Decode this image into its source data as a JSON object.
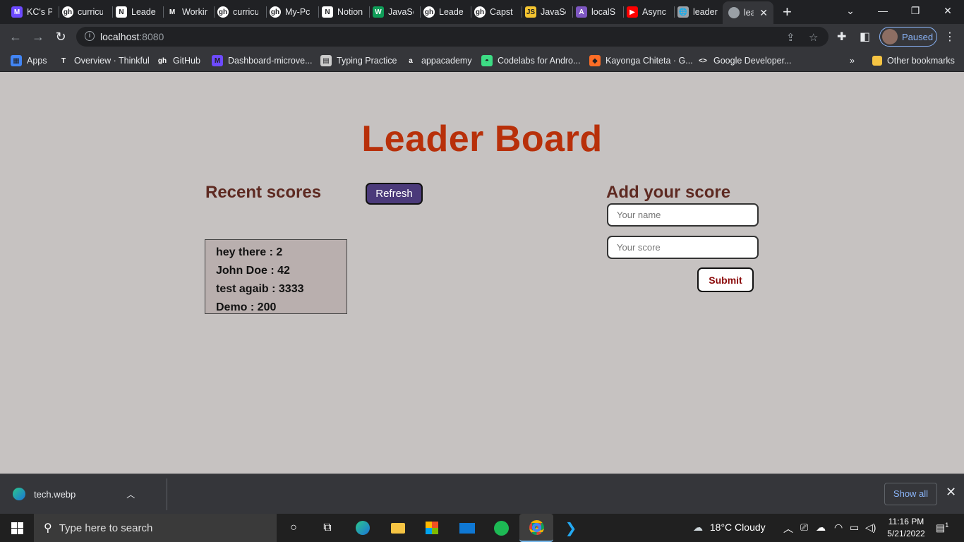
{
  "browser": {
    "tabs": [
      {
        "title": "KC's P",
        "color": "#6d4aff",
        "icon": "M"
      },
      {
        "title": "curricu",
        "color": "#ffffff",
        "icon": "gh"
      },
      {
        "title": "Leade",
        "color": "#ffffff",
        "icon": "N"
      },
      {
        "title": "Workin",
        "color": "#202124",
        "icon": "M"
      },
      {
        "title": "curricu",
        "color": "#ffffff",
        "icon": "gh"
      },
      {
        "title": "My-Pc",
        "color": "#ffffff",
        "icon": "gh"
      },
      {
        "title": "Notion",
        "color": "#ffffff",
        "icon": "N"
      },
      {
        "title": "JavaSc",
        "color": "#0f9d58",
        "icon": "W"
      },
      {
        "title": "Leade",
        "color": "#ffffff",
        "icon": "gh"
      },
      {
        "title": "Capst",
        "color": "#ffffff",
        "icon": "gh"
      },
      {
        "title": "JavaSc",
        "color": "#f4c430",
        "icon": "JS"
      },
      {
        "title": "localS",
        "color": "#7e57c2",
        "icon": "A"
      },
      {
        "title": "Async",
        "color": "#ff0000",
        "icon": "▶"
      },
      {
        "title": "leader",
        "color": "#9aa0a6",
        "icon": "🌐"
      }
    ],
    "active_tab": {
      "title": "lea",
      "icon": "🌐"
    },
    "url_host": "localhost",
    "url_port": ":8080",
    "profile_label": "Paused",
    "bookmarks": [
      {
        "label": "Apps",
        "color": "#4285f4",
        "icon": "▦"
      },
      {
        "label": "Overview · Thinkful",
        "color": "#ffffff",
        "icon": "T"
      },
      {
        "label": "GitHub",
        "color": "#ffffff",
        "icon": "gh"
      },
      {
        "label": "Dashboard-microve...",
        "color": "#6d4aff",
        "icon": "M"
      },
      {
        "label": "Typing Practice",
        "color": "#cccccc",
        "icon": "▤"
      },
      {
        "label": "appacademy",
        "color": "#111111",
        "icon": "a"
      },
      {
        "label": "Codelabs for Andro...",
        "color": "#3ddc84",
        "icon": "◓"
      },
      {
        "label": "Kayonga Chiteta · G...",
        "color": "#fc6d26",
        "icon": "◆"
      },
      {
        "label": "Google Developer...",
        "color": "#ffffff",
        "icon": "<>"
      }
    ],
    "bookmarks_overflow": "»",
    "other_bookmarks": "Other bookmarks"
  },
  "page": {
    "title": "Leader Board",
    "recent_heading": "Recent scores",
    "refresh_label": "Refresh",
    "scores": [
      "hey there : 2",
      "John Doe : 42",
      "test agaib : 3333",
      "Demo : 200"
    ],
    "add_heading": "Add your score",
    "name_placeholder": "Your name",
    "score_placeholder": "Your score",
    "submit_label": "Submit"
  },
  "downloads": {
    "file": "tech.webp",
    "show_all": "Show all"
  },
  "taskbar": {
    "search_placeholder": "Type here to search",
    "weather": "18°C  Cloudy",
    "time": "11:16 PM",
    "date": "5/21/2022",
    "notifications": "1"
  }
}
